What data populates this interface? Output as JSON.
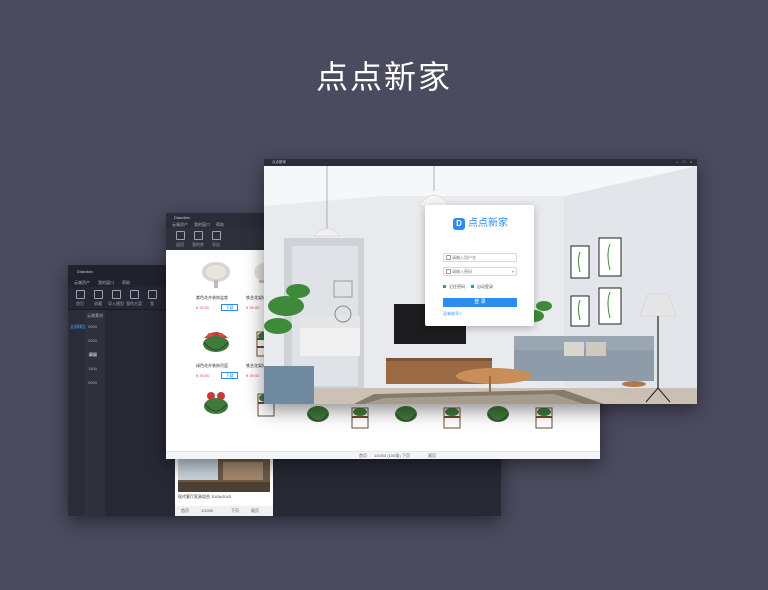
{
  "page_title": "点点新家",
  "colors": {
    "background": "#4a4b5e",
    "accent": "#2b8cf2",
    "price": "#e5484d",
    "window_dark": "#2a2d38"
  },
  "back_window": {
    "app_name": "Diandian",
    "menus": [
      "云端资产",
      "我的窗口",
      "帮助"
    ],
    "tools": [
      "首页",
      "收藏",
      "导入模型",
      "我的方案",
      "我"
    ],
    "sidebar1": [
      "全部模型"
    ],
    "sidebar2": [
      "云端素材"
    ],
    "sidebar2_items": [
      "3000",
      "2000",
      "1000",
      "1500",
      "3000"
    ],
    "sidebar3_items": [
      "家居"
    ],
    "cards": [
      {
        "title": "现代客厅家具组合 2043x2043",
        "btn1": "导入模型",
        "btn2": "收藏"
      },
      {
        "title": "现代客厅家具组合 2043x2043",
        "btn1": "导入模型",
        "btn2": "收藏"
      },
      {
        "title": "现代客厅家具组合 2043x2043"
      }
    ],
    "pager": {
      "prev": "首页",
      "info": "1/1000",
      "next": "下页",
      "last": "尾页"
    }
  },
  "middle_window": {
    "app_name": "Diandian",
    "menus": [
      "云端资产",
      "我的窗口",
      "帮助"
    ],
    "tools": [
      "返回",
      "我的库",
      "导出"
    ],
    "cells": [
      {
        "label": "紫色花卉装饰盆栽",
        "price": "¥ 39.00",
        "dl": "下载"
      },
      {
        "label": "铁艺花架绿植盆栽",
        "price": "¥ 39.00",
        "dl": "下载"
      },
      {
        "label": "绿色花卉装饰吊篮",
        "price": "¥ 39.00",
        "dl": "下载"
      },
      {
        "label": "铁艺花架绿植盆栽",
        "price": "¥ 39.00",
        "dl": "下载"
      }
    ],
    "pager": {
      "prev": "首页",
      "info": "1/1000 (100条)",
      "next": "下页",
      "last": "尾页"
    }
  },
  "front_window": {
    "app_name": "点点新家",
    "login": {
      "logo_text": "点点新家",
      "username_placeholder": "请输入用户名",
      "password_placeholder": "请输入密码",
      "remember": "记住密码",
      "auto_login": "自动登录",
      "login_button": "登 录",
      "no_account": "没有账号?"
    }
  }
}
